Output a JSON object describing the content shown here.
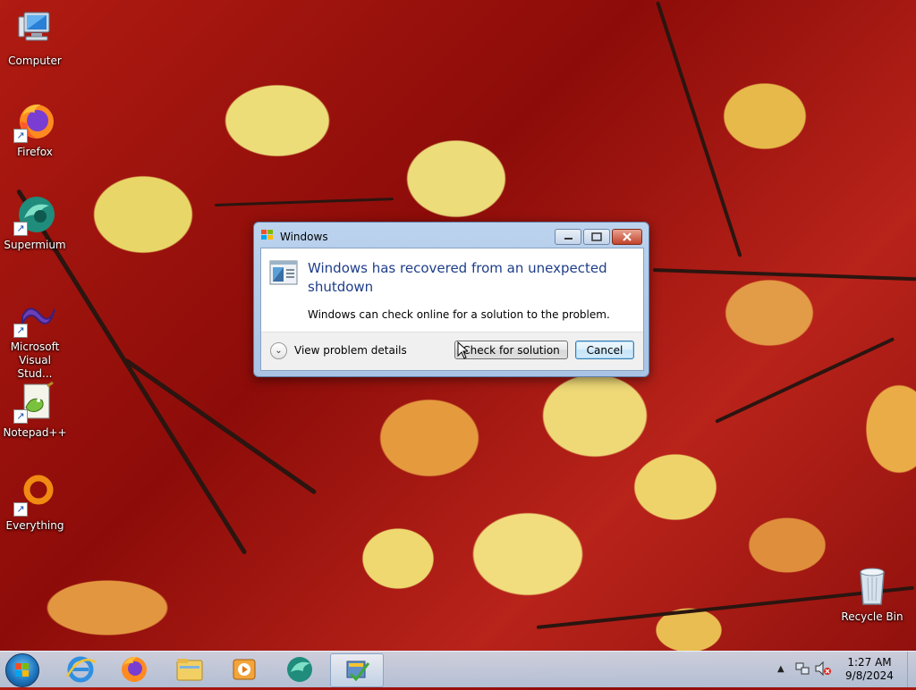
{
  "desktop": {
    "icons": [
      {
        "label": "Computer"
      },
      {
        "label": "Firefox"
      },
      {
        "label": "Supermium"
      },
      {
        "label": "Microsoft Visual Stud..."
      },
      {
        "label": "Notepad++"
      },
      {
        "label": "Everything"
      },
      {
        "label": "Recycle Bin"
      }
    ]
  },
  "dialog": {
    "title": "Windows",
    "heading": "Windows has recovered from an unexpected shutdown",
    "description": "Windows can check online for a solution to the problem.",
    "details_label": "View problem details",
    "primary_button": "Check for solution",
    "cancel_button": "Cancel"
  },
  "taskbar": {
    "time": "1:27 AM",
    "date": "9/8/2024"
  }
}
